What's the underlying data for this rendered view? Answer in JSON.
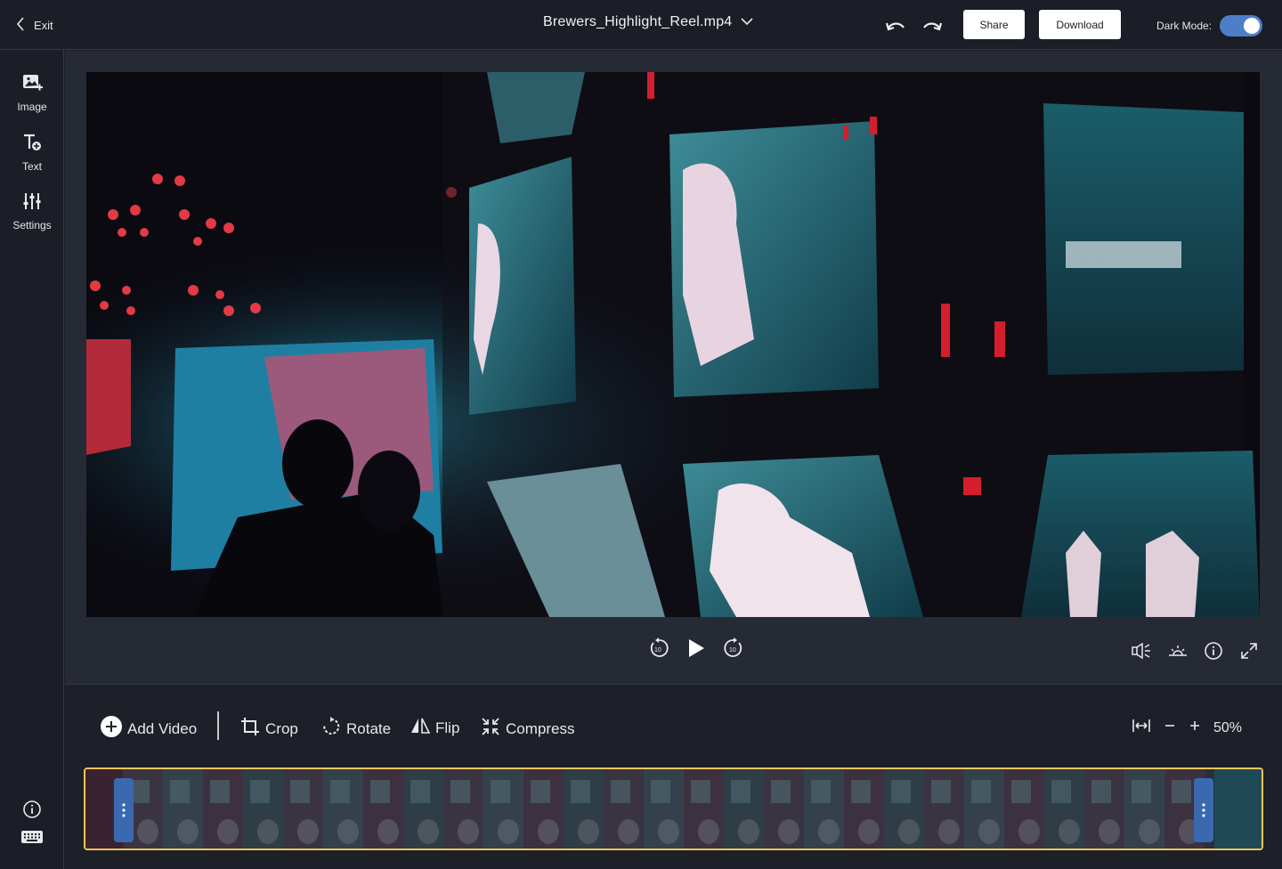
{
  "header": {
    "exit_label": "Exit",
    "file_name": "Brewers_Highlight_Reel.mp4",
    "share_label": "Share",
    "download_label": "Download",
    "dark_mode_label": "Dark Mode:",
    "dark_mode_on": true
  },
  "sidebar": {
    "items": [
      {
        "label": "Image",
        "icon": "add-image-icon"
      },
      {
        "label": "Text",
        "icon": "add-text-icon"
      },
      {
        "label": "Settings",
        "icon": "sliders-icon"
      }
    ],
    "bottom_icons": [
      "info-icon",
      "keyboard-icon"
    ]
  },
  "player": {
    "center_controls": [
      "rewind-10-icon",
      "play-icon",
      "forward-10-icon"
    ],
    "rewind_seconds": "10",
    "forward_seconds": "10",
    "right_controls": [
      "volume-icon",
      "brightness-icon",
      "info-icon",
      "fullscreen-icon"
    ]
  },
  "toolbar": {
    "add_video_label": "Add Video",
    "crop_label": "Crop",
    "rotate_label": "Rotate",
    "flip_label": "Flip",
    "compress_label": "Compress",
    "zoom_value": "50%"
  },
  "colors": {
    "accent": "#4f7ec9",
    "timeline_border": "#f0c65a",
    "handle": "#3a69b0",
    "background": "#1d2029",
    "stage": "#262a35"
  }
}
